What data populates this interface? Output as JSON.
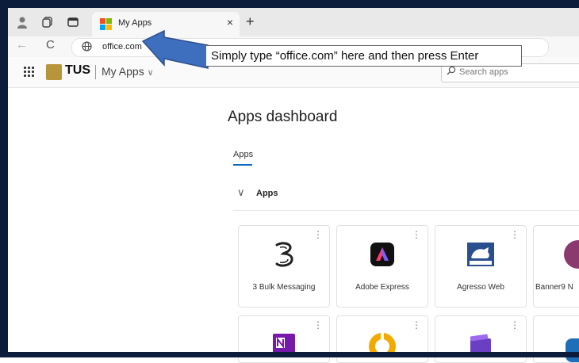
{
  "browser": {
    "tab_title": "My Apps",
    "tab_close": "×",
    "new_tab": "+",
    "url": "office.com",
    "back": "←",
    "reload": "C"
  },
  "header": {
    "logo_text": "TUS",
    "app_title": "My Apps",
    "app_chevron": "∨",
    "search_placeholder": "Search apps"
  },
  "main": {
    "title": "Apps dashboard",
    "tabs": [
      {
        "label": "Apps"
      }
    ],
    "section": "Apps",
    "section_chevron": "∨",
    "cards": [
      {
        "name": "3 Bulk Messaging",
        "icon": "three-logo-icon"
      },
      {
        "name": "Adobe Express",
        "icon": "adobe-express-icon"
      },
      {
        "name": "Agresso Web",
        "icon": "agresso-icon"
      },
      {
        "name": "Banner9 N",
        "icon": "banner9-icon"
      },
      {
        "name": "",
        "icon": "onenote-icon"
      },
      {
        "name": "",
        "icon": "orange-ring-icon"
      },
      {
        "name": "",
        "icon": "purple-app-icon"
      },
      {
        "name": "",
        "icon": "blue-app-icon"
      }
    ],
    "more": "⋮"
  },
  "callout": {
    "text": "Simply type “office.com” here and then press Enter"
  },
  "colors": {
    "accent": "#0f6cbd",
    "arrow": "#3e6fbf",
    "agresso": "#2a4f8f",
    "banner": "#8b3a70",
    "onenote": "#7719aa"
  }
}
